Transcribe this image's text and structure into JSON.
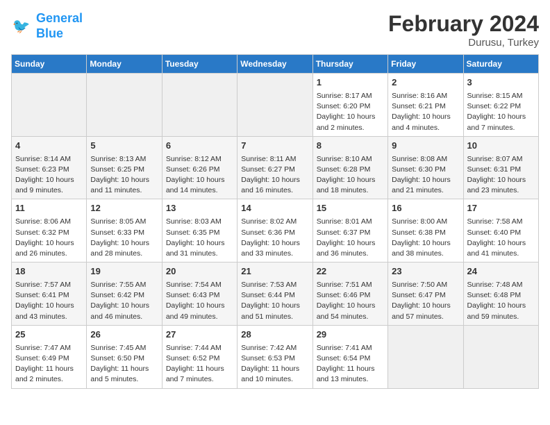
{
  "header": {
    "logo_line1": "General",
    "logo_line2": "Blue",
    "month": "February 2024",
    "location": "Durusu, Turkey"
  },
  "days_of_week": [
    "Sunday",
    "Monday",
    "Tuesday",
    "Wednesday",
    "Thursday",
    "Friday",
    "Saturday"
  ],
  "weeks": [
    [
      {
        "num": "",
        "data": ""
      },
      {
        "num": "",
        "data": ""
      },
      {
        "num": "",
        "data": ""
      },
      {
        "num": "",
        "data": ""
      },
      {
        "num": "1",
        "data": "Sunrise: 8:17 AM\nSunset: 6:20 PM\nDaylight: 10 hours and 2 minutes."
      },
      {
        "num": "2",
        "data": "Sunrise: 8:16 AM\nSunset: 6:21 PM\nDaylight: 10 hours and 4 minutes."
      },
      {
        "num": "3",
        "data": "Sunrise: 8:15 AM\nSunset: 6:22 PM\nDaylight: 10 hours and 7 minutes."
      }
    ],
    [
      {
        "num": "4",
        "data": "Sunrise: 8:14 AM\nSunset: 6:23 PM\nDaylight: 10 hours and 9 minutes."
      },
      {
        "num": "5",
        "data": "Sunrise: 8:13 AM\nSunset: 6:25 PM\nDaylight: 10 hours and 11 minutes."
      },
      {
        "num": "6",
        "data": "Sunrise: 8:12 AM\nSunset: 6:26 PM\nDaylight: 10 hours and 14 minutes."
      },
      {
        "num": "7",
        "data": "Sunrise: 8:11 AM\nSunset: 6:27 PM\nDaylight: 10 hours and 16 minutes."
      },
      {
        "num": "8",
        "data": "Sunrise: 8:10 AM\nSunset: 6:28 PM\nDaylight: 10 hours and 18 minutes."
      },
      {
        "num": "9",
        "data": "Sunrise: 8:08 AM\nSunset: 6:30 PM\nDaylight: 10 hours and 21 minutes."
      },
      {
        "num": "10",
        "data": "Sunrise: 8:07 AM\nSunset: 6:31 PM\nDaylight: 10 hours and 23 minutes."
      }
    ],
    [
      {
        "num": "11",
        "data": "Sunrise: 8:06 AM\nSunset: 6:32 PM\nDaylight: 10 hours and 26 minutes."
      },
      {
        "num": "12",
        "data": "Sunrise: 8:05 AM\nSunset: 6:33 PM\nDaylight: 10 hours and 28 minutes."
      },
      {
        "num": "13",
        "data": "Sunrise: 8:03 AM\nSunset: 6:35 PM\nDaylight: 10 hours and 31 minutes."
      },
      {
        "num": "14",
        "data": "Sunrise: 8:02 AM\nSunset: 6:36 PM\nDaylight: 10 hours and 33 minutes."
      },
      {
        "num": "15",
        "data": "Sunrise: 8:01 AM\nSunset: 6:37 PM\nDaylight: 10 hours and 36 minutes."
      },
      {
        "num": "16",
        "data": "Sunrise: 8:00 AM\nSunset: 6:38 PM\nDaylight: 10 hours and 38 minutes."
      },
      {
        "num": "17",
        "data": "Sunrise: 7:58 AM\nSunset: 6:40 PM\nDaylight: 10 hours and 41 minutes."
      }
    ],
    [
      {
        "num": "18",
        "data": "Sunrise: 7:57 AM\nSunset: 6:41 PM\nDaylight: 10 hours and 43 minutes."
      },
      {
        "num": "19",
        "data": "Sunrise: 7:55 AM\nSunset: 6:42 PM\nDaylight: 10 hours and 46 minutes."
      },
      {
        "num": "20",
        "data": "Sunrise: 7:54 AM\nSunset: 6:43 PM\nDaylight: 10 hours and 49 minutes."
      },
      {
        "num": "21",
        "data": "Sunrise: 7:53 AM\nSunset: 6:44 PM\nDaylight: 10 hours and 51 minutes."
      },
      {
        "num": "22",
        "data": "Sunrise: 7:51 AM\nSunset: 6:46 PM\nDaylight: 10 hours and 54 minutes."
      },
      {
        "num": "23",
        "data": "Sunrise: 7:50 AM\nSunset: 6:47 PM\nDaylight: 10 hours and 57 minutes."
      },
      {
        "num": "24",
        "data": "Sunrise: 7:48 AM\nSunset: 6:48 PM\nDaylight: 10 hours and 59 minutes."
      }
    ],
    [
      {
        "num": "25",
        "data": "Sunrise: 7:47 AM\nSunset: 6:49 PM\nDaylight: 11 hours and 2 minutes."
      },
      {
        "num": "26",
        "data": "Sunrise: 7:45 AM\nSunset: 6:50 PM\nDaylight: 11 hours and 5 minutes."
      },
      {
        "num": "27",
        "data": "Sunrise: 7:44 AM\nSunset: 6:52 PM\nDaylight: 11 hours and 7 minutes."
      },
      {
        "num": "28",
        "data": "Sunrise: 7:42 AM\nSunset: 6:53 PM\nDaylight: 11 hours and 10 minutes."
      },
      {
        "num": "29",
        "data": "Sunrise: 7:41 AM\nSunset: 6:54 PM\nDaylight: 11 hours and 13 minutes."
      },
      {
        "num": "",
        "data": ""
      },
      {
        "num": "",
        "data": ""
      }
    ]
  ]
}
